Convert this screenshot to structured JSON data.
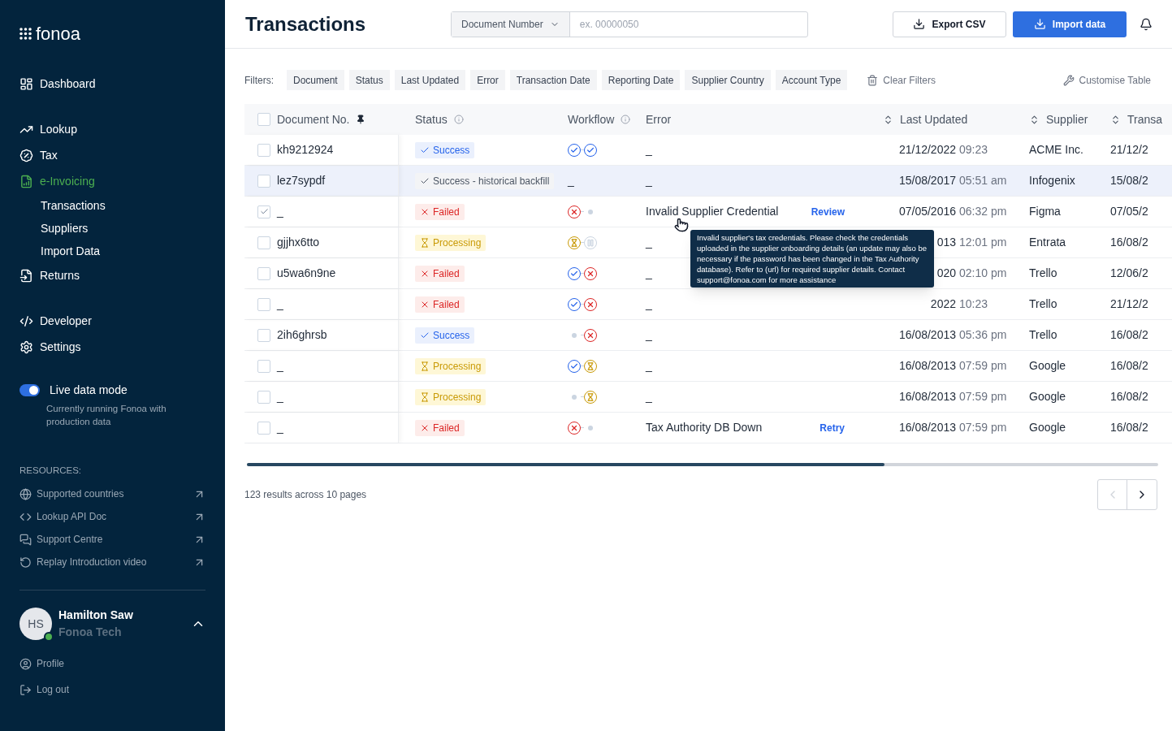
{
  "brand": {
    "name": "fonoa"
  },
  "nav_groups": [
    [
      {
        "label": "Dashboard",
        "kind": "dashboard",
        "selected": false
      }
    ],
    [
      {
        "label": "Lookup",
        "kind": "lookup",
        "selected": false
      },
      {
        "label": "Tax",
        "kind": "tax",
        "selected": false
      },
      {
        "label": "e-Invoicing",
        "kind": "invoicing",
        "selected": true,
        "children": [
          {
            "label": "Transactions"
          },
          {
            "label": "Suppliers"
          },
          {
            "label": "Import Data"
          }
        ]
      },
      {
        "label": "Returns",
        "kind": "returns",
        "selected": false
      }
    ],
    [
      {
        "label": "Developer",
        "kind": "developer",
        "selected": false
      },
      {
        "label": "Settings",
        "kind": "settings",
        "selected": false
      }
    ]
  ],
  "live_mode": {
    "label": "Live data mode",
    "on": true,
    "description": "Currently running Fonoa with production data"
  },
  "resources": {
    "title": "RESOURCES:",
    "items": [
      {
        "label": "Supported countries",
        "kind": "globe"
      },
      {
        "label": "Lookup API Doc",
        "kind": "code"
      },
      {
        "label": "Support Centre",
        "kind": "chat"
      },
      {
        "label": "Replay Introduction video",
        "kind": "replay"
      }
    ]
  },
  "user": {
    "initials": "HS",
    "name": "Hamilton Saw",
    "company": "Fonoa Tech",
    "online": true
  },
  "account_links": [
    {
      "label": "Profile",
      "kind": "profile"
    },
    {
      "label": "Log out",
      "kind": "logout"
    }
  ],
  "header": {
    "title": "Transactions",
    "search_field": "Document Number",
    "placeholder": "ex. 00000050",
    "export": "Export CSV",
    "import": "Import data"
  },
  "filters": {
    "label": "Filters:",
    "chips": [
      "Document",
      "Status",
      "Last Updated",
      "Error",
      "Transaction Date",
      "Reporting Date",
      "Supplier Country",
      "Account Type"
    ],
    "clear": "Clear Filters",
    "customise": "Customise Table"
  },
  "select_all_checked": false,
  "columns": [
    {
      "label": "Document No.",
      "kind": "pinned"
    },
    {
      "label": "Status",
      "kind": "info"
    },
    {
      "label": "Workflow",
      "kind": "info"
    },
    {
      "label": "Error",
      "kind": "plain"
    },
    {
      "label": "Last Updated",
      "kind": "sort"
    },
    {
      "label": "Supplier",
      "kind": "sort"
    },
    {
      "label": "Transa",
      "kind": "sort"
    }
  ],
  "rows": [
    {
      "doc": "kh9212924",
      "checked": false,
      "highlighted": false,
      "status": {
        "kind": "success",
        "label": "Success"
      },
      "workflow": [
        {
          "kind": "done"
        },
        {
          "kind": "done"
        }
      ],
      "error": "_",
      "date": "21/12/2022",
      "time": "09:23",
      "supplier": "ACME Inc.",
      "transaction": "21/12/2"
    },
    {
      "doc": "lez7sypdf",
      "checked": false,
      "highlighted": true,
      "status": {
        "kind": "backfill",
        "label": "Success - historical backfill"
      },
      "workflow_text": "_",
      "error": "_",
      "date": "15/08/2017",
      "time": "05:51 am",
      "supplier": "Infogenix",
      "transaction": "15/08/2"
    },
    {
      "doc": "_",
      "checked": true,
      "highlighted": false,
      "status": {
        "kind": "failed",
        "label": "Failed"
      },
      "workflow": [
        {
          "kind": "failed"
        },
        {
          "kind": "idle"
        }
      ],
      "error": "Invalid Supplier Credential",
      "action": "Review",
      "date": "07/05/2016",
      "time": "06:32 pm",
      "supplier": "Figma",
      "transaction": "07/05/2"
    },
    {
      "doc": "gjjhx6tto",
      "checked": false,
      "highlighted": false,
      "status": {
        "kind": "processing",
        "label": "Processing"
      },
      "workflow": [
        {
          "kind": "pending"
        },
        {
          "kind": "paused"
        }
      ],
      "error": "_",
      "date": "013",
      "time": "12:01 pm",
      "supplier": "Entrata",
      "transaction": "16/08/2"
    },
    {
      "doc": "u5wa6n9ne",
      "checked": false,
      "highlighted": false,
      "status": {
        "kind": "failed",
        "label": "Failed"
      },
      "workflow": [
        {
          "kind": "done"
        },
        {
          "kind": "failed"
        }
      ],
      "error": "_",
      "date": "020",
      "time": "02:10 pm",
      "supplier": "Trello",
      "transaction": "12/06/2"
    },
    {
      "doc": "_",
      "checked": false,
      "highlighted": false,
      "status": {
        "kind": "failed",
        "label": "Failed"
      },
      "workflow": [
        {
          "kind": "done"
        },
        {
          "kind": "failed"
        }
      ],
      "error": "_",
      "date": "2022",
      "time": "10:23",
      "supplier": "Trello",
      "transaction": "21/12/2"
    },
    {
      "doc": "2ih6ghrsb",
      "checked": false,
      "highlighted": false,
      "status": {
        "kind": "success",
        "label": "Success"
      },
      "workflow": [
        {
          "kind": "idle"
        },
        {
          "kind": "failed"
        }
      ],
      "error": "_",
      "date": "16/08/2013",
      "time": "05:36 pm",
      "supplier": "Trello",
      "transaction": "16/08/2"
    },
    {
      "doc": "_",
      "checked": false,
      "highlighted": false,
      "status": {
        "kind": "processing",
        "label": "Processing"
      },
      "workflow": [
        {
          "kind": "done"
        },
        {
          "kind": "pending"
        }
      ],
      "error": "_",
      "date": "16/08/2013",
      "time": "07:59 pm",
      "supplier": "Google",
      "transaction": "16/08/2"
    },
    {
      "doc": "_",
      "checked": false,
      "highlighted": false,
      "status": {
        "kind": "processing",
        "label": "Processing"
      },
      "workflow": [
        {
          "kind": "idle"
        },
        {
          "kind": "pending"
        }
      ],
      "error": "_",
      "date": "16/08/2013",
      "time": "07:59 pm",
      "supplier": "Google",
      "transaction": "16/08/2"
    },
    {
      "doc": "_",
      "checked": false,
      "highlighted": false,
      "status": {
        "kind": "failed",
        "label": "Failed"
      },
      "workflow": [
        {
          "kind": "failed"
        },
        {
          "kind": "idle"
        }
      ],
      "error": "Tax Authority DB Down",
      "action": "Retry",
      "date": "16/08/2013",
      "time": "07:59 pm",
      "supplier": "Google",
      "transaction": "16/08/2"
    }
  ],
  "tooltip": "Invalid supplier's tax credentials. Please check the credentials uploaded in the supplier onboarding details (an update may also be necessary if the password has been changed in the Tax Authority database). Refer to (url) for required supplier details. Contact support@fonoa.com for more assistance",
  "footer": {
    "results": "123 results across 10 pages",
    "prev_disabled": true,
    "next_disabled": false
  }
}
